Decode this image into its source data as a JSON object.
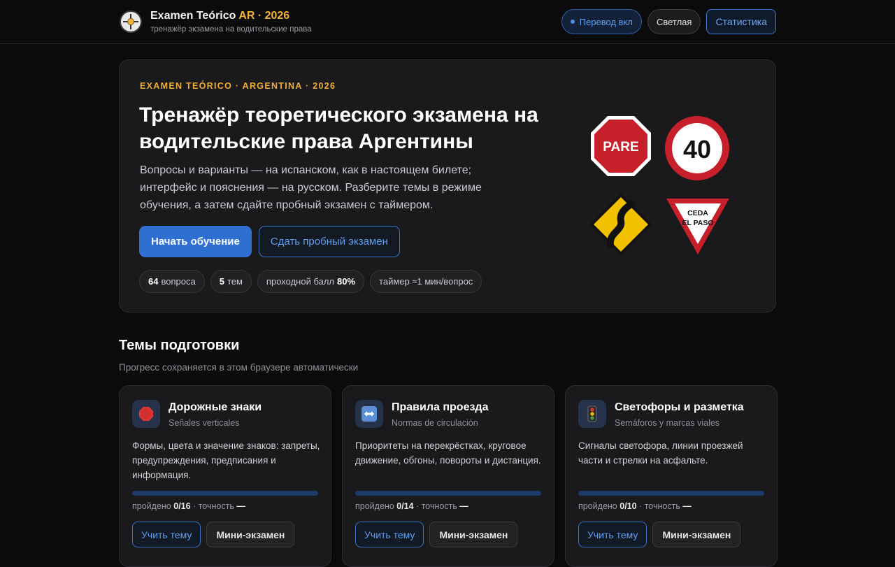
{
  "header": {
    "title_main": "Examen Teórico",
    "title_accent": "AR · 2026",
    "subtitle": "тренажёр экзамена на водительские права",
    "translate_label": "Перевод вкл",
    "theme_label": "Светлая",
    "stats_label": "Статистика"
  },
  "hero": {
    "eyebrow": "EXAMEN TEÓRICO · ARGENTINA · 2026",
    "title": "Тренажёр теоретического экзамена на водительские права Аргентины",
    "description": "Вопросы и варианты — на испанском, как в настоящем билете; интерфейс и пояснения — на русском. Разберите темы в режиме обучения, а затем сдайте пробный экзамен с таймером.",
    "primary_label": "Начать обучение",
    "secondary_label": "Сдать пробный экзамен",
    "chips": {
      "questions_num": "64",
      "questions_text": "вопроса",
      "topics_num": "5",
      "topics_text": "тем",
      "pass_text": "проходной балл",
      "pass_num": "80%",
      "timer_text": "таймер ≈1 мин/вопрос"
    },
    "signs": {
      "stop_text": "PARE",
      "speed_text": "40",
      "yield_line1": "CEDA",
      "yield_line2": "EL PASO"
    }
  },
  "topics": {
    "title": "Темы подготовки",
    "subtitle": "Прогресс сохраняется в этом браузере автоматически",
    "cards": [
      {
        "icon": "stop-sign-icon",
        "title": "Дорожные знаки",
        "subtitle": "Señales verticales",
        "description": "Формы, цвета и значение знаков: запреты, предупреждения, предписания и информация.",
        "passed_label": "пройдено",
        "passed": "0/16",
        "accuracy_label": "· точность",
        "accuracy": "—",
        "progress": 0,
        "learn_label": "Учить тему",
        "mini_label": "Мини-экзамен"
      },
      {
        "icon": "left-right-arrow-icon",
        "title": "Правила проезда",
        "subtitle": "Normas de circulación",
        "description": "Приоритеты на перекрёстках, круговое движение, обгоны, повороты и дистанция.",
        "passed_label": "пройдено",
        "passed": "0/14",
        "accuracy_label": "· точность",
        "accuracy": "—",
        "progress": 0,
        "learn_label": "Учить тему",
        "mini_label": "Мини-экзамен"
      },
      {
        "icon": "traffic-light-icon",
        "title": "Светофоры и разметка",
        "subtitle": "Semáforos y marcas viales",
        "description": "Сигналы светофора, линии проезжей части и стрелки на асфальте.",
        "passed_label": "пройдено",
        "passed": "0/10",
        "accuracy_label": "· точность",
        "accuracy": "—",
        "progress": 0,
        "learn_label": "Учить тему",
        "mini_label": "Мини-экзамен"
      }
    ]
  },
  "colors": {
    "accent_blue": "#2f6fd1",
    "accent_gold": "#f2b338",
    "sign_red": "#c8202b",
    "sign_yellow": "#f2c200"
  }
}
